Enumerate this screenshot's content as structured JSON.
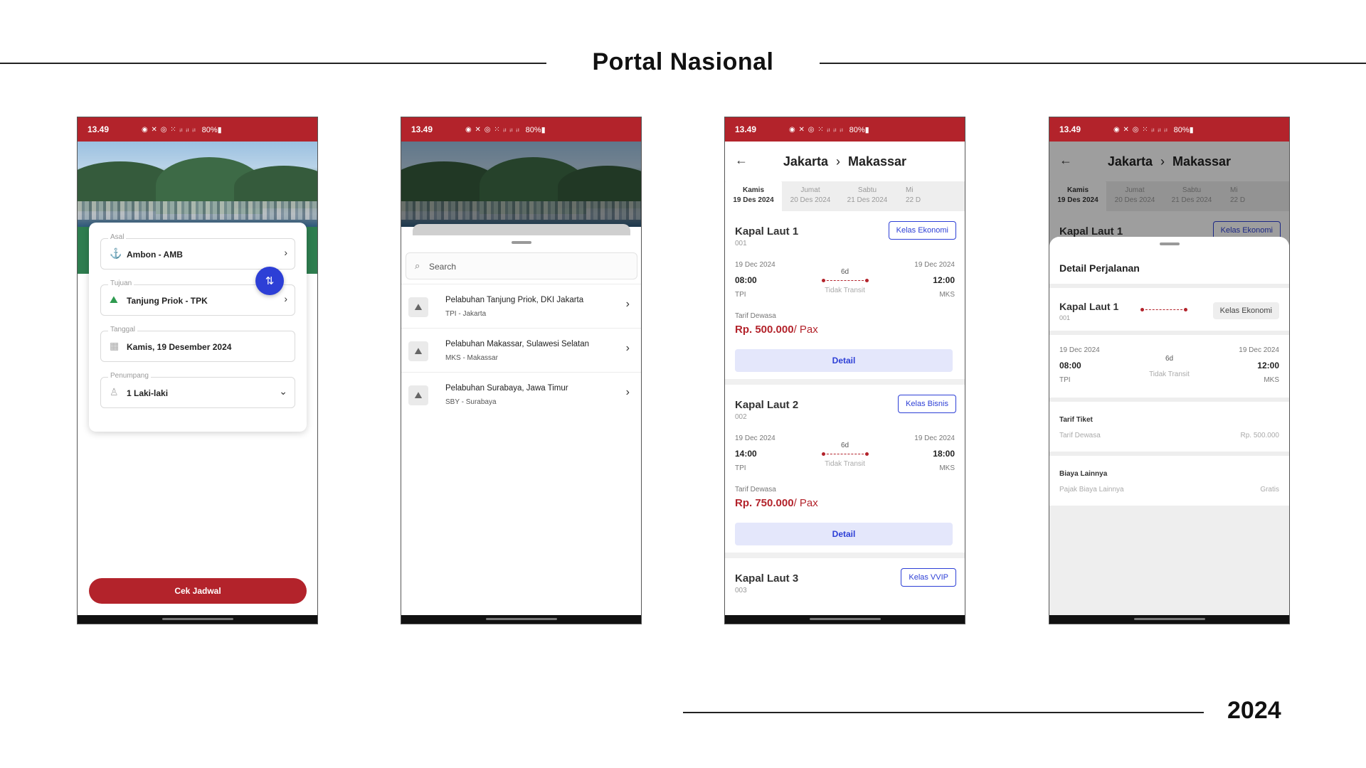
{
  "page": {
    "title": "Portal Nasional",
    "year": "2024"
  },
  "status": {
    "time": "13.49",
    "icons": "◉ ✕ ◎ ⁙ ᵢₗ ᵢₗ ᵢₗ",
    "battery": "80%▮"
  },
  "screen1": {
    "origin": {
      "label": "Asal",
      "value": "Ambon - AMB"
    },
    "destination": {
      "label": "Tujuan",
      "value": "Tanjung Priok - TPK"
    },
    "date": {
      "label": "Tanggal",
      "value": "Kamis, 19 Desember 2024"
    },
    "passenger": {
      "label": "Penumpang",
      "value": "1 Laki-laki"
    },
    "submit_label": "Cek Jadwal"
  },
  "screen2": {
    "search_placeholder": "Search",
    "ports": [
      {
        "name": "Pelabuhan Tanjung Priok, DKI Jakarta",
        "code": "TPI - Jakarta"
      },
      {
        "name": "Pelabuhan Makassar, Sulawesi Selatan",
        "code": "MKS - Makassar"
      },
      {
        "name": "Pelabuhan Surabaya, Jawa Timur",
        "code": "SBY - Surabaya"
      }
    ]
  },
  "route": {
    "from": "Jakarta",
    "to": "Makassar"
  },
  "date_tabs": [
    {
      "day": "Kamis",
      "date": "19 Des 2024"
    },
    {
      "day": "Jumat",
      "date": "20 Des 2024"
    },
    {
      "day": "Sabtu",
      "date": "21 Des 2024"
    },
    {
      "day": "Mi",
      "date": "22 D"
    }
  ],
  "trips": [
    {
      "ship": "Kapal Laut 1",
      "code": "001",
      "class": "Kelas Ekonomi",
      "dep_date": "19 Dec 2024",
      "arr_date": "19 Dec 2024",
      "dep_time": "08:00",
      "arr_time": "12:00",
      "dep_port": "TPI",
      "arr_port": "MKS",
      "duration": "6d",
      "transit": "Tidak Transit",
      "fare_label": "Tarif Dewasa",
      "price": "Rp. 500.000",
      "price_unit": "/ Pax",
      "detail_label": "Detail"
    },
    {
      "ship": "Kapal Laut 2",
      "code": "002",
      "class": "Kelas Bisnis",
      "dep_date": "19 Dec 2024",
      "arr_date": "19 Dec 2024",
      "dep_time": "14:00",
      "arr_time": "18:00",
      "dep_port": "TPI",
      "arr_port": "MKS",
      "duration": "6d",
      "transit": "Tidak Transit",
      "fare_label": "Tarif Dewasa",
      "price": "Rp. 750.000",
      "price_unit": "/ Pax",
      "detail_label": "Detail"
    },
    {
      "ship": "Kapal Laut 3",
      "code": "003",
      "class": "Kelas VVIP"
    }
  ],
  "detail_sheet": {
    "title": "Detail Perjalanan",
    "ship": "Kapal Laut 1",
    "code": "001",
    "class": "Kelas Ekonomi",
    "dep_date": "19 Dec 2024",
    "arr_date": "19 Dec 2024",
    "dep_time": "08:00",
    "arr_time": "12:00",
    "dep_port": "TPI",
    "arr_port": "MKS",
    "duration": "6d",
    "transit": "Tidak Transit",
    "fare_heading": "Tarif Tiket",
    "fare_row_label": "Tarif Dewasa",
    "fare_row_value": "Rp. 500.000",
    "other_heading": "Biaya Lainnya",
    "other_row_label": "Pajak Biaya Lainnya",
    "other_row_value": "Gratis"
  },
  "colors": {
    "brand_red": "#b3232b",
    "accent_blue": "#2d3fd6",
    "hero_green": "#2e7d4f"
  }
}
